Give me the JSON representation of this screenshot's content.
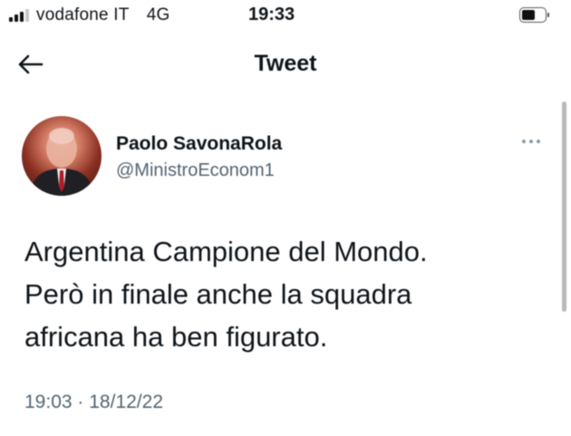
{
  "status_bar": {
    "carrier": "vodafone IT",
    "network": "4G",
    "time": "19:33",
    "signal_bars_active": 3,
    "signal_bars_total": 4
  },
  "header": {
    "title": "Tweet",
    "back_icon": "arrow-left-icon"
  },
  "tweet": {
    "author_name": "Paolo SavonaRola",
    "author_handle": "@MinistroEconom1",
    "text_lines": [
      "Argentina Campione del Mondo.",
      "Però in finale anche la squadra",
      "africana ha ben figurato."
    ],
    "time": "19:03",
    "separator": "·",
    "date": "18/12/22",
    "more_icon": "more-horizontal-icon"
  },
  "colors": {
    "text_primary": "#0f1419",
    "text_secondary": "#536471",
    "background": "#ffffff"
  }
}
